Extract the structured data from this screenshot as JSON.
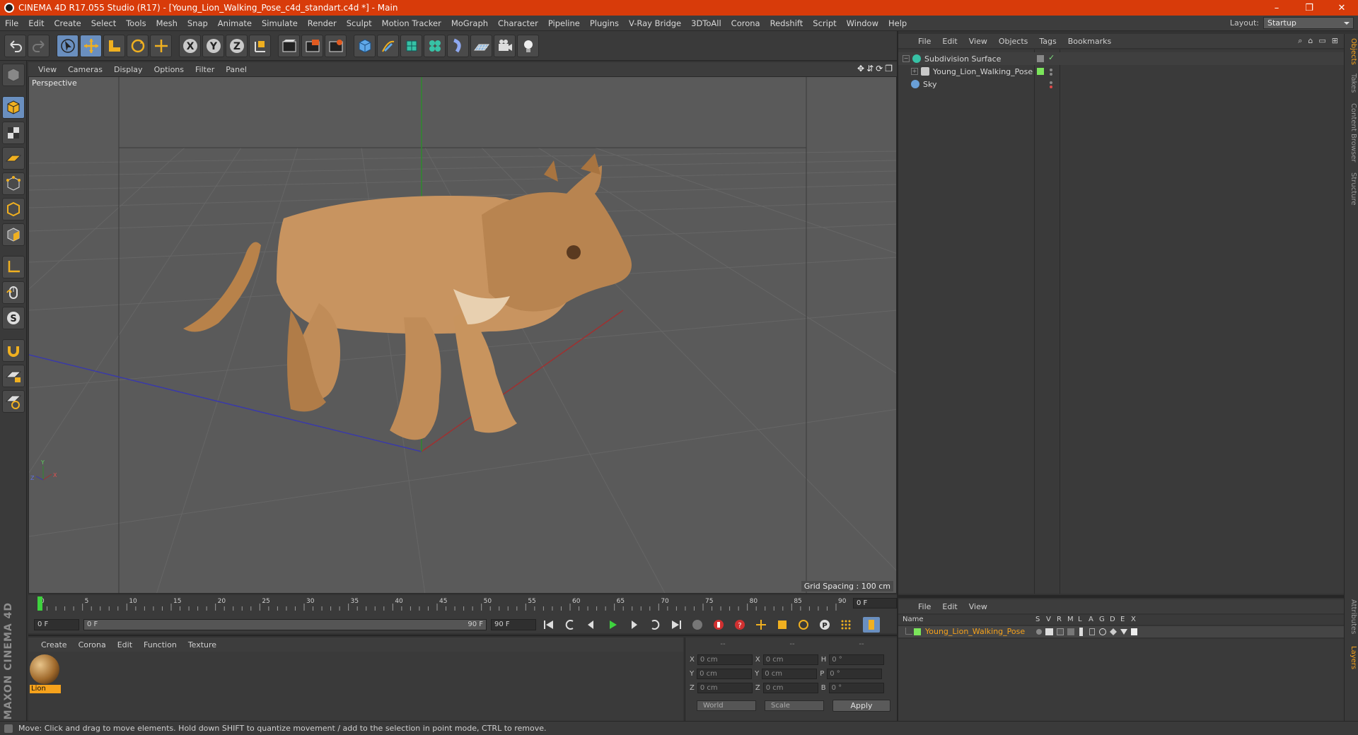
{
  "window": {
    "title": "CINEMA 4D R17.055 Studio (R17) - [Young_Lion_Walking_Pose_c4d_standart.c4d *] - Main",
    "controls": [
      "–",
      "❐",
      "✕"
    ]
  },
  "menubar": {
    "items": [
      "File",
      "Edit",
      "Create",
      "Select",
      "Tools",
      "Mesh",
      "Snap",
      "Animate",
      "Simulate",
      "Render",
      "Sculpt",
      "Motion Tracker",
      "MoGraph",
      "Character",
      "Pipeline",
      "Plugins",
      "V-Ray Bridge",
      "3DToAll",
      "Corona",
      "Redshift",
      "Script",
      "Window",
      "Help"
    ],
    "layout_label": "Layout:",
    "layout_value": "Startup"
  },
  "toolbar": {
    "tools": [
      "undo-icon",
      "redo-icon",
      "select-arrow-icon",
      "move-icon",
      "scale-icon",
      "rotate-icon",
      "transform-icon",
      "x-axis-icon",
      "y-axis-icon",
      "z-axis-icon",
      "coordinate-system-icon",
      "render-view-icon",
      "render-picture-viewer-icon",
      "render-settings-icon",
      "cube-icon",
      "pen-icon",
      "subdivision-icon",
      "cloner-icon",
      "deformer-icon",
      "floor-icon",
      "camera-icon",
      "light-icon"
    ]
  },
  "viewport": {
    "menu": [
      "View",
      "Cameras",
      "Display",
      "Options",
      "Filter",
      "Panel"
    ],
    "label": "Perspective",
    "grid_spacing": "Grid Spacing : 100 cm",
    "axis_labels": {
      "y": "Y",
      "x": "X",
      "z": "Z"
    }
  },
  "timeline": {
    "ticks": [
      "0",
      "5",
      "10",
      "15",
      "20",
      "25",
      "30",
      "35",
      "40",
      "45",
      "50",
      "55",
      "60",
      "65",
      "70",
      "75",
      "80",
      "85",
      "90"
    ],
    "current_frame": "0 F",
    "start_field": "0 F",
    "range_start": "0 F",
    "range_end": "90 F",
    "end_field": "90 F"
  },
  "material_manager": {
    "menu": [
      "Create",
      "Corona",
      "Edit",
      "Function",
      "Texture"
    ],
    "materials": [
      {
        "name": "Lion"
      }
    ]
  },
  "coordinates": {
    "headers": [
      "--",
      "--",
      "--"
    ],
    "rows": [
      {
        "l1": "X",
        "v1": "0 cm",
        "l2": "X",
        "v2": "0 cm",
        "l3": "H",
        "v3": "0 °"
      },
      {
        "l1": "Y",
        "v1": "0 cm",
        "l2": "Y",
        "v2": "0 cm",
        "l3": "P",
        "v3": "0 °"
      },
      {
        "l1": "Z",
        "v1": "0 cm",
        "l2": "Z",
        "v2": "0 cm",
        "l3": "B",
        "v3": "0 °"
      }
    ],
    "mode_world": "World",
    "mode_scale": "Scale",
    "apply": "Apply"
  },
  "object_manager": {
    "menu": [
      "File",
      "Edit",
      "View",
      "Objects",
      "Tags",
      "Bookmarks"
    ],
    "objects": [
      {
        "name": "Subdivision Surface",
        "icon_color": "#37c2a6",
        "tag": "✓",
        "tag_color": "#7fe07f"
      },
      {
        "name": "Young_Lion_Walking_Pose",
        "icon_color": "#c8c8c8",
        "tag": "",
        "tag_color": "#7be55b"
      },
      {
        "name": "Sky",
        "icon_color": "#6aa0d8",
        "tag": "",
        "tag_color": "#e04a4a"
      }
    ]
  },
  "side_tabs": [
    "Objects",
    "Takes",
    "Content Browser",
    "Structure",
    "Attributes",
    "Layers"
  ],
  "layer_manager": {
    "menu": [
      "File",
      "Edit",
      "View"
    ],
    "columns": [
      "Name",
      "S",
      "V",
      "R",
      "M",
      "L",
      "A",
      "G",
      "D",
      "E",
      "X"
    ],
    "layers": [
      {
        "name": "Young_Lion_Walking_Pose",
        "color": "#7be55b"
      }
    ]
  },
  "status": {
    "text": "Move: Click and drag to move elements. Hold down SHIFT to quantize movement / add to the selection in point mode, CTRL to remove."
  },
  "brand": {
    "logo_text": "MAXON CINEMA 4D"
  },
  "colors": {
    "accent": "#d83b0a",
    "selection": "#f6a21c",
    "active_tool": "#6a8fbf"
  }
}
